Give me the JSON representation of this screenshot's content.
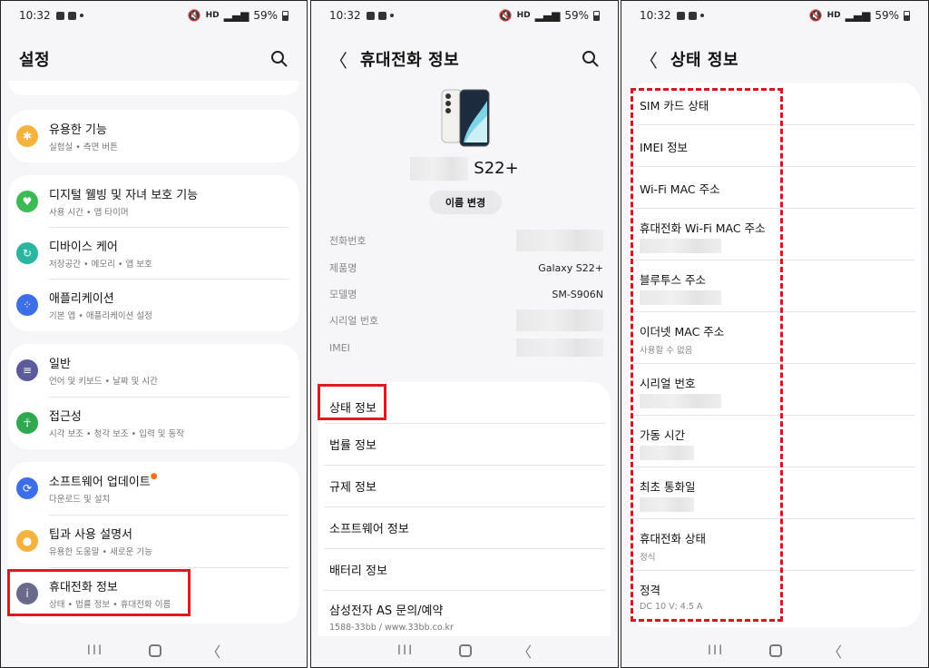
{
  "status": {
    "time": "10:32",
    "battery": "59%",
    "hd": "HD"
  },
  "nav": {
    "recents": "III",
    "back": "〈"
  },
  "panel1": {
    "title": "설정",
    "items": [
      {
        "label": "유용한 기능",
        "sub": "실험실 • 측면 버튼",
        "color": "#f4b33f"
      },
      {
        "label": "디지털 웰빙 및 자녀 보호 기능",
        "sub": "사용 시간 • 앱 타이머",
        "color": "#3cba54"
      },
      {
        "label": "디바이스 케어",
        "sub": "저장공간 • 메모리 • 앱 보호",
        "color": "#2bb5a0"
      },
      {
        "label": "애플리케이션",
        "sub": "기본 앱 • 애플리케이션 설정",
        "color": "#3c6ee8"
      },
      {
        "label": "일반",
        "sub": "언어 및 키보드 • 날짜 및 시간",
        "color": "#5c5c9c"
      },
      {
        "label": "접근성",
        "sub": "시각 보조 • 청각 보조 • 입력 및 동작",
        "color": "#2fa84f"
      },
      {
        "label": "소프트웨어 업데이트",
        "sub": "다운로드 및 설치",
        "color": "#3c6ee8"
      },
      {
        "label": "팁과 사용 설명서",
        "sub": "유용한 도움말 • 새로운 기능",
        "color": "#f4b33f"
      },
      {
        "label": "휴대전화 정보",
        "sub": "상태 • 법률 정보 • 휴대전화 이름",
        "color": "#6a6a8c"
      }
    ]
  },
  "panel2": {
    "title": "휴대전화 정보",
    "model_suffix": "S22+",
    "rename": "이름 변경",
    "info": [
      {
        "label": "전화번호",
        "value": ""
      },
      {
        "label": "제품명",
        "value": "Galaxy S22+"
      },
      {
        "label": "모델명",
        "value": "SM-S906N"
      },
      {
        "label": "시리얼 번호",
        "value": ""
      },
      {
        "label": "IMEI",
        "value": ""
      }
    ],
    "menu": [
      {
        "label": "상태 정보"
      },
      {
        "label": "법률 정보"
      },
      {
        "label": "규제 정보"
      },
      {
        "label": "소프트웨어 정보"
      },
      {
        "label": "배터리 정보"
      },
      {
        "label": "삼성전자 AS 문의/예약",
        "sub": "1588-33bb / www.33bb.co.kr"
      }
    ]
  },
  "panel3": {
    "title": "상태 정보",
    "items": [
      {
        "label": "SIM 카드 상태"
      },
      {
        "label": "IMEI 정보"
      },
      {
        "label": "Wi-Fi MAC 주소"
      },
      {
        "label": "휴대전화 Wi-Fi MAC 주소"
      },
      {
        "label": "블루투스 주소"
      },
      {
        "label": "이더넷 MAC 주소",
        "sub": "사용할 수 없음"
      },
      {
        "label": "시리얼 번호"
      },
      {
        "label": "가동 시간"
      },
      {
        "label": "최초 통화일"
      },
      {
        "label": "휴대전화 상태",
        "sub": "정식"
      },
      {
        "label": "정격",
        "sub": "DC 10 V; 4.5 A"
      }
    ]
  }
}
